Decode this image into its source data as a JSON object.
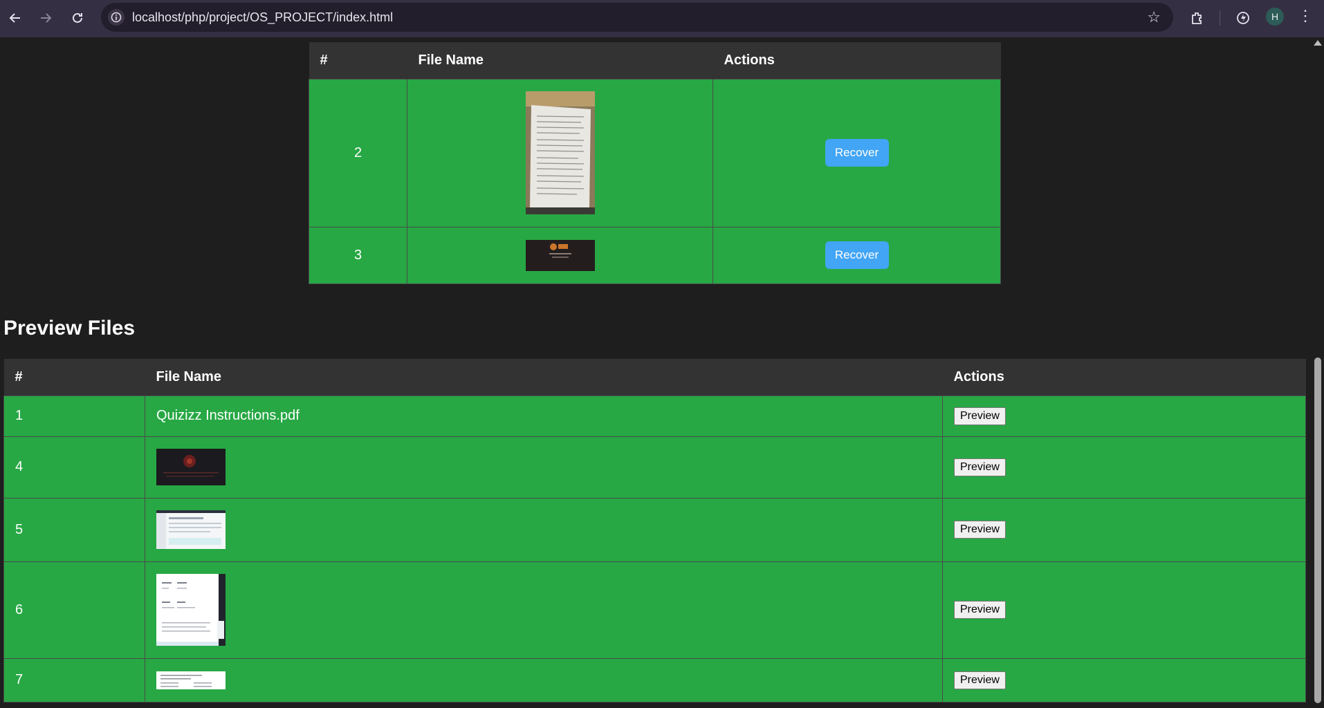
{
  "browser": {
    "url": "localhost/php/project/OS_PROJECT/index.html",
    "profile_initial": "H"
  },
  "recover_table": {
    "headers": [
      "#",
      "File Name",
      "Actions"
    ],
    "rows": [
      {
        "id": "2",
        "thumb": "document-photo",
        "action": "Recover"
      },
      {
        "id": "3",
        "thumb": "dark-slide",
        "action": "Recover"
      }
    ]
  },
  "preview_section": {
    "title": "Preview Files",
    "headers": [
      "#",
      "File Name",
      "Actions"
    ],
    "rows": [
      {
        "id": "1",
        "file_name": "Quizizz Instructions.pdf",
        "action": "Preview"
      },
      {
        "id": "4",
        "thumb": "dark-red-screenshot",
        "action": "Preview"
      },
      {
        "id": "5",
        "thumb": "web-app-screenshot",
        "action": "Preview"
      },
      {
        "id": "6",
        "thumb": "form-screenshot",
        "action": "Preview"
      },
      {
        "id": "7",
        "thumb": "text-document-strip",
        "action": "Preview"
      }
    ]
  },
  "colors": {
    "row_green": "#27a844",
    "header_bg": "#333333",
    "page_bg": "#1e1e1e",
    "recover_blue": "#42a5f5"
  }
}
